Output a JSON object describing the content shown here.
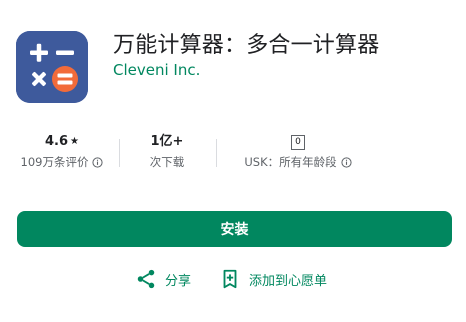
{
  "app": {
    "title": "万能计算器：多合一计算器",
    "developer": "Cleveni Inc."
  },
  "stats": {
    "rating_value": "4.6",
    "rating_star": "★",
    "rating_label": "109万条评价",
    "downloads_value": "1亿+",
    "downloads_label": "次下载",
    "age_badge": "0",
    "age_label": "USK：所有年龄段"
  },
  "buttons": {
    "install_label": "安装",
    "share_label": "分享",
    "wishlist_label": "添加到心愿单"
  },
  "colors": {
    "accent": "#01875f",
    "icon_bg": "#3e5a9c",
    "icon_equals": "#f26b3a"
  },
  "icons": [
    "calculator-app-icon",
    "star-icon",
    "info-icon",
    "usk-age-badge",
    "share-icon",
    "wishlist-bookmark-icon"
  ]
}
